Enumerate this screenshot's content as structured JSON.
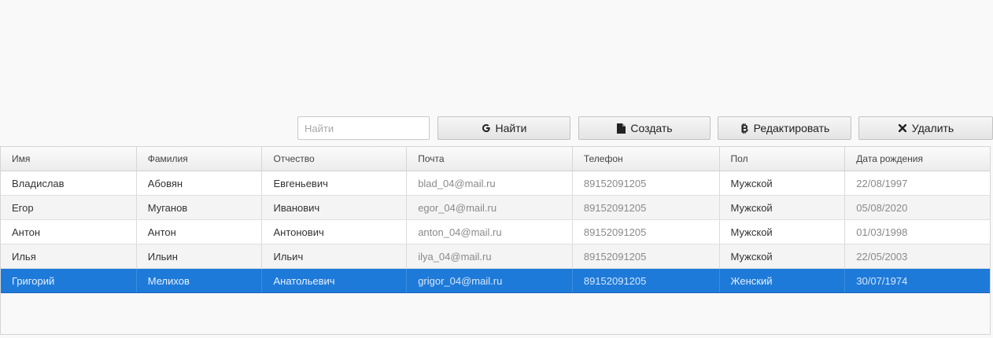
{
  "toolbar": {
    "search_placeholder": "Найти",
    "find_label": "Найти",
    "create_label": "Создать",
    "edit_label": "Редактировать",
    "delete_label": "Удалить",
    "icons": {
      "find": "google-g-icon",
      "create": "file-icon",
      "edit": "bitcoin-icon",
      "delete": "close-icon"
    }
  },
  "table": {
    "columns": [
      "Имя",
      "Фамилия",
      "Отчество",
      "Почта",
      "Телефон",
      "Пол",
      "Дата рождения"
    ],
    "rows": [
      [
        "Владислав",
        "Абовян",
        "Евгеньевич",
        "blad_04@mail.ru",
        "89152091205",
        "Мужской",
        "22/08/1997"
      ],
      [
        "Егор",
        "Муганов",
        "Иванович",
        "egor_04@mail.ru",
        "89152091205",
        "Мужской",
        "05/08/2020"
      ],
      [
        "Антон",
        "Антон",
        "Антонович",
        "anton_04@mail.ru",
        "89152091205",
        "Мужской",
        "01/03/1998"
      ],
      [
        "Илья",
        "Ильин",
        "Ильич",
        "ilya_04@mail.ru",
        "89152091205",
        "Мужской",
        "22/05/2003"
      ],
      [
        "Григорий",
        "Мелихов",
        "Анатольевич",
        "grigor_04@mail.ru",
        "89152091205",
        "Женский",
        "30/07/1974"
      ]
    ],
    "selected_row": 4
  },
  "colors": {
    "selection": "#1e7ad8",
    "background": "#f9f9f9"
  }
}
